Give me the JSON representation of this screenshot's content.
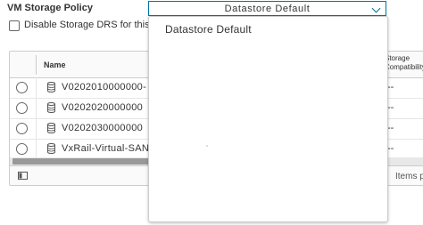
{
  "storage_policy": {
    "label": "VM Storage Policy",
    "selected": "Datastore Default"
  },
  "drs": {
    "label": "Disable Storage DRS for this",
    "checked": false
  },
  "grid": {
    "columns": [
      "Name",
      "Storage Compatibility"
    ],
    "rows": [
      {
        "name": "V0202010000000-",
        "compatibility": "--"
      },
      {
        "name": "V0202020000000",
        "compatibility": "--"
      },
      {
        "name": "V0202030000000",
        "compatibility": "--"
      },
      {
        "name": "VxRail-Virtual-SAN-",
        "compatibility": "--"
      }
    ],
    "footer_items_label": "Items p"
  },
  "dropdown": {
    "options": [
      "Datastore Default"
    ]
  },
  "colors": {
    "accent": "#0072a3",
    "border": "#cccccc"
  }
}
